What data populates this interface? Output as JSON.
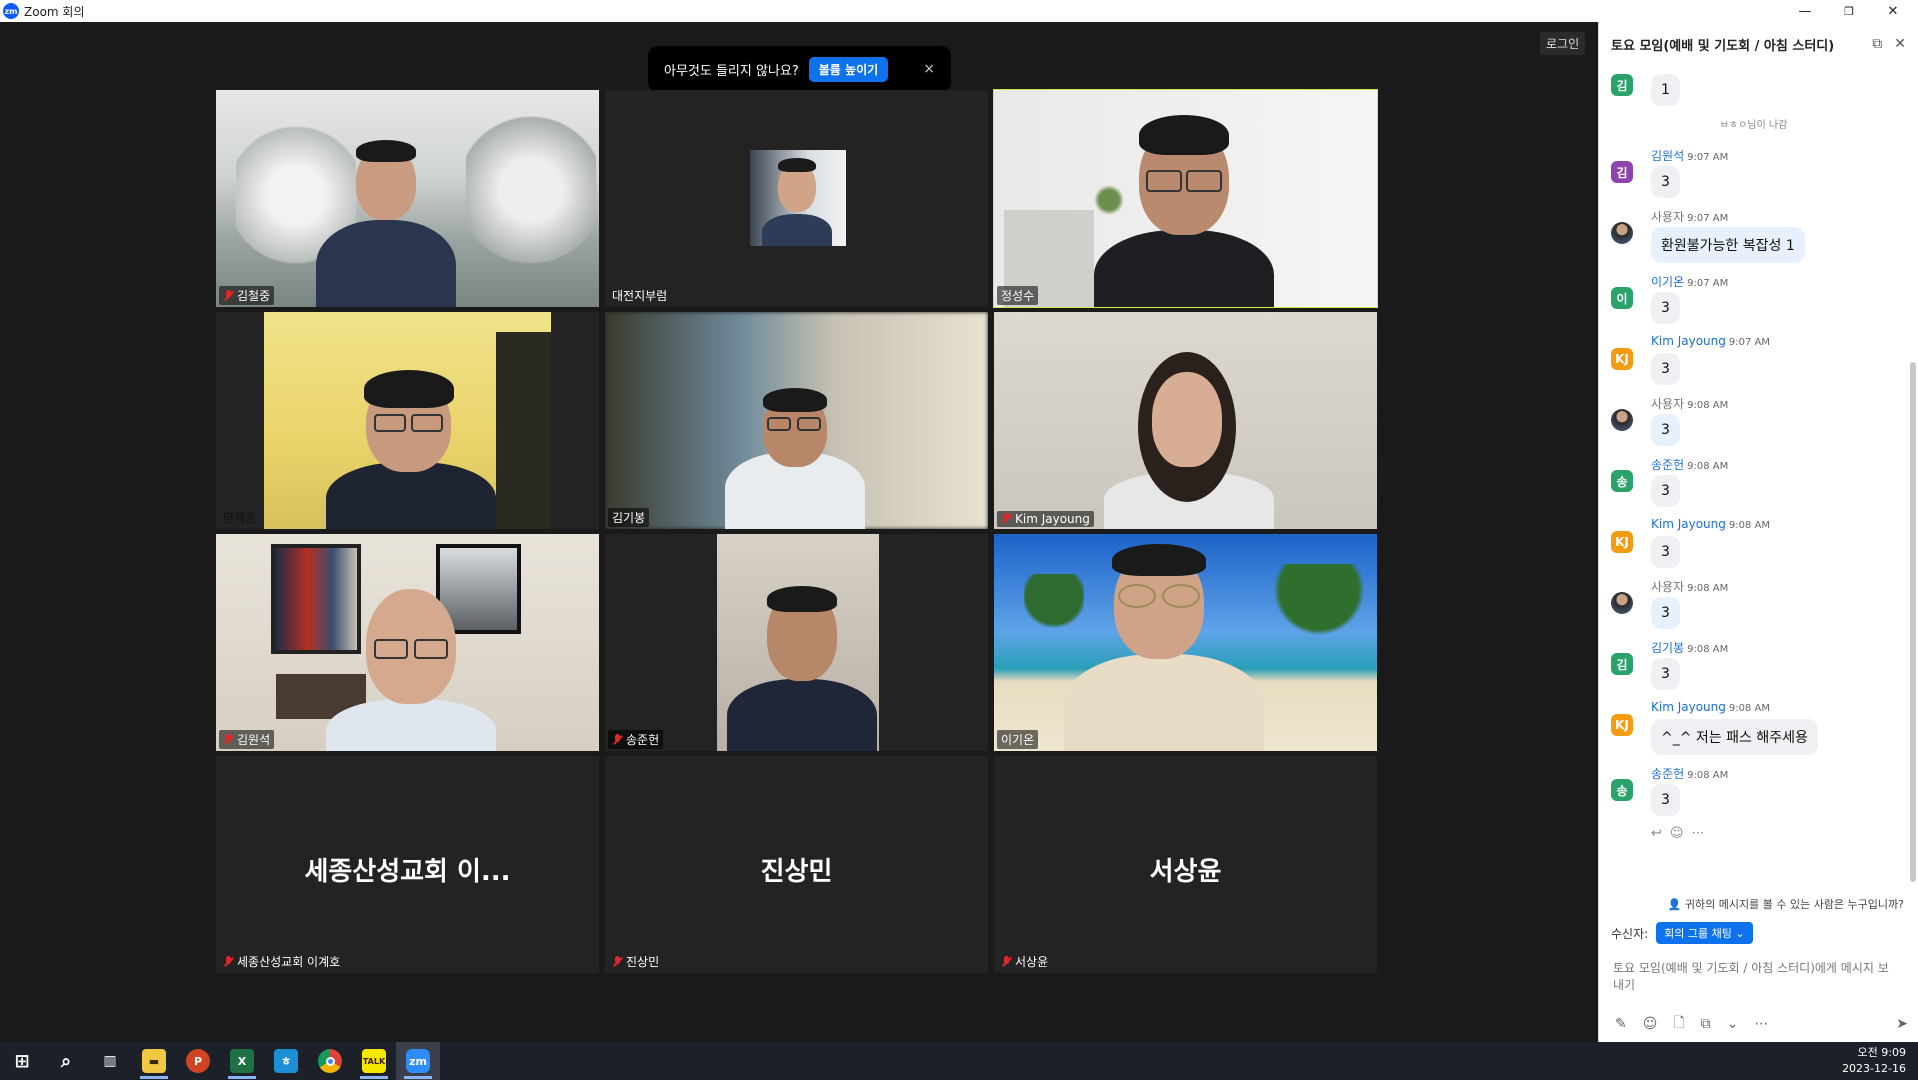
{
  "window": {
    "title": "Zoom 회의",
    "logo_text": "zm"
  },
  "meeting": {
    "notice_text": "아무것도 들리지 않나요?",
    "notice_button": "볼륨 높이기",
    "notice_close": "×",
    "signin_label": "로그인",
    "tiles": [
      {
        "name": "김철중",
        "muted": true
      },
      {
        "name": "대전지부럼",
        "muted": false
      },
      {
        "name": "정성수",
        "muted": false,
        "active": true
      },
      {
        "name": "명재준",
        "muted": false
      },
      {
        "name": "김기봉",
        "muted": false
      },
      {
        "name": "Kim Jayoung",
        "muted": true
      },
      {
        "name": "김원석",
        "muted": true
      },
      {
        "name": "송준헌",
        "muted": true
      },
      {
        "name": "이기온",
        "muted": false
      },
      {
        "name": "세종산성교회 이계호",
        "display": "세종산성교회 이...",
        "muted": true
      },
      {
        "name": "진상민",
        "display": "진상민",
        "muted": true
      },
      {
        "name": "서상윤",
        "display": "서상윤",
        "muted": true
      }
    ]
  },
  "chat": {
    "title": "토요 모임(예배 및 기도회 / 아침 스터디)",
    "popout_icon": "popout-icon",
    "close_icon": "close-icon",
    "first_msg": {
      "avatar": "김",
      "color": "#2aa36b",
      "text": "1"
    },
    "system_note": "ㅂㅎㅇ님이 나감",
    "messages": [
      {
        "sender": "김원석",
        "time": "9:07 AM",
        "avatar": "김",
        "color": "#8e44ad",
        "text": "3",
        "blue": false
      },
      {
        "sender": "사용자",
        "time": "9:07 AM",
        "avatar": "",
        "color": "#5a5a5a",
        "text": "환원불가능한 복잡성 1",
        "blue": true,
        "self": true
      },
      {
        "sender": "이기온",
        "time": "9:07 AM",
        "avatar": "이",
        "color": "#2aa36b",
        "text": "3",
        "blue": false
      },
      {
        "sender": "Kim Jayoung",
        "time": "9:07 AM",
        "avatar": "KJ",
        "color": "#f39c12",
        "text": "3",
        "blue": false
      },
      {
        "sender": "사용자",
        "time": "9:08 AM",
        "avatar": "",
        "color": "#5a5a5a",
        "text": "3",
        "blue": true,
        "self": true
      },
      {
        "sender": "송준헌",
        "time": "9:08 AM",
        "avatar": "송",
        "color": "#2aa36b",
        "text": "3",
        "blue": false
      },
      {
        "sender": "Kim Jayoung",
        "time": "9:08 AM",
        "avatar": "KJ",
        "color": "#f39c12",
        "text": "3",
        "blue": false
      },
      {
        "sender": "사용자",
        "time": "9:08 AM",
        "avatar": "",
        "color": "#5a5a5a",
        "text": "3",
        "blue": true,
        "self": true
      },
      {
        "sender": "김기봉",
        "time": "9:08 AM",
        "avatar": "김",
        "color": "#2aa36b",
        "text": "3",
        "blue": false
      },
      {
        "sender": "Kim Jayoung",
        "time": "9:08 AM",
        "avatar": "KJ",
        "color": "#f39c12",
        "text": "^_^ 저는 패스 해주세용",
        "blue": false
      },
      {
        "sender": "송준헌",
        "time": "9:08 AM",
        "avatar": "송",
        "color": "#2aa36b",
        "text": "3",
        "blue": false
      }
    ],
    "who_can_see": "귀하의 메시지를 볼 수 있는 사람은 누구입니까?",
    "recipient_label": "수신자:",
    "recipient_value": "회의 그룹 채팅",
    "composer_placeholder": "토요 모임(예배 및 기도회 / 아침 스터디)에게 메시지 보내기"
  },
  "taskbar": {
    "icons": [
      "windows-start-icon",
      "search-icon",
      "task-view-icon",
      "file-explorer-icon",
      "powerpoint-icon",
      "excel-icon",
      "hangul-icon",
      "chrome-icon",
      "kakaotalk-icon",
      "zoom-icon"
    ],
    "time": "오전 9:09",
    "date": "2023-12-16"
  }
}
